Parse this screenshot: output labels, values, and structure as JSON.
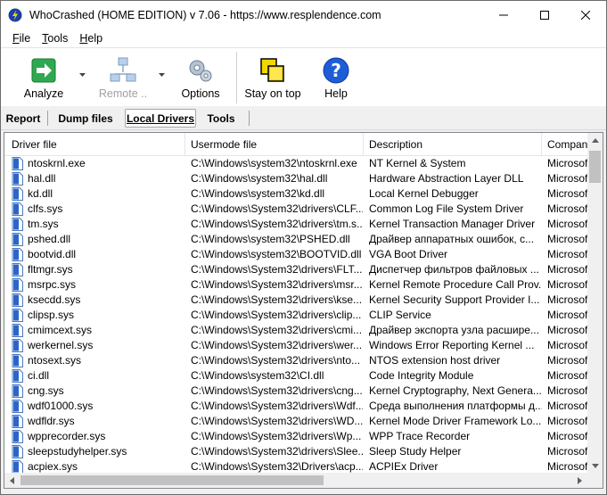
{
  "window": {
    "title": "WhoCrashed  (HOME EDITION)  v 7.06  -   https://www.resplendence.com",
    "controls": [
      "minimize",
      "maximize",
      "close"
    ]
  },
  "menu": [
    {
      "label": "File"
    },
    {
      "label": "Tools"
    },
    {
      "label": "Help"
    }
  ],
  "toolbar": {
    "analyze": "Analyze",
    "remote": "Remote ..",
    "options": "Options",
    "stay_on_top": "Stay on top",
    "help": "Help"
  },
  "tabs": [
    {
      "label": "Report",
      "active": false
    },
    {
      "label": "Dump files",
      "active": false
    },
    {
      "label": "Local Drivers",
      "active": true
    },
    {
      "label": "Tools",
      "active": false
    }
  ],
  "table": {
    "columns": [
      "Driver file",
      "Usermode file",
      "Description",
      "Company"
    ],
    "rows": [
      [
        "ntoskrnl.exe",
        "C:\\Windows\\system32\\ntoskrnl.exe",
        "NT Kernel & System",
        "Microsoft"
      ],
      [
        "hal.dll",
        "C:\\Windows\\system32\\hal.dll",
        "Hardware Abstraction Layer DLL",
        "Microsoft"
      ],
      [
        "kd.dll",
        "C:\\Windows\\system32\\kd.dll",
        "Local Kernel Debugger",
        "Microsoft"
      ],
      [
        "clfs.sys",
        "C:\\Windows\\System32\\drivers\\CLF...",
        "Common Log File System Driver",
        "Microsoft"
      ],
      [
        "tm.sys",
        "C:\\Windows\\System32\\drivers\\tm.s...",
        "Kernel Transaction Manager Driver",
        "Microsoft"
      ],
      [
        "pshed.dll",
        "C:\\Windows\\system32\\PSHED.dll",
        "Драйвер аппаратных ошибок, с...",
        "Microsoft"
      ],
      [
        "bootvid.dll",
        "C:\\Windows\\system32\\BOOTVID.dll",
        "VGA Boot Driver",
        "Microsoft"
      ],
      [
        "fltmgr.sys",
        "C:\\Windows\\System32\\drivers\\FLT...",
        "Диспетчер фильтров файловых ...",
        "Microsoft"
      ],
      [
        "msrpc.sys",
        "C:\\Windows\\System32\\drivers\\msr...",
        "Kernel Remote Procedure Call Prov...",
        "Microsoft"
      ],
      [
        "ksecdd.sys",
        "C:\\Windows\\System32\\drivers\\kse...",
        "Kernel Security Support Provider I...",
        "Microsoft"
      ],
      [
        "clipsp.sys",
        "C:\\Windows\\System32\\drivers\\clip...",
        "CLIP Service",
        "Microsoft"
      ],
      [
        "cmimcext.sys",
        "C:\\Windows\\System32\\drivers\\cmi...",
        "Драйвер экспорта узла расшире...",
        "Microsoft"
      ],
      [
        "werkernel.sys",
        "C:\\Windows\\System32\\drivers\\wer...",
        "Windows Error Reporting Kernel ...",
        "Microsoft"
      ],
      [
        "ntosext.sys",
        "C:\\Windows\\System32\\drivers\\nto...",
        "NTOS extension host driver",
        "Microsoft"
      ],
      [
        "ci.dll",
        "C:\\Windows\\system32\\CI.dll",
        "Code Integrity Module",
        "Microsoft"
      ],
      [
        "cng.sys",
        "C:\\Windows\\System32\\drivers\\cng...",
        "Kernel Cryptography, Next Genera...",
        "Microsoft"
      ],
      [
        "wdf01000.sys",
        "C:\\Windows\\System32\\drivers\\Wdf...",
        "Среда выполнения платформы д...",
        "Microsoft"
      ],
      [
        "wdfldr.sys",
        "C:\\Windows\\System32\\drivers\\WD...",
        "Kernel Mode Driver Framework Lo...",
        "Microsoft"
      ],
      [
        "wpprecorder.sys",
        "C:\\Windows\\System32\\drivers\\Wp...",
        "WPP Trace Recorder",
        "Microsoft"
      ],
      [
        "sleepstudyhelper.sys",
        "C:\\Windows\\System32\\drivers\\Slee...",
        "Sleep Study Helper",
        "Microsoft"
      ],
      [
        "acpiex.sys",
        "C:\\Windows\\System32\\Drivers\\acp...",
        "ACPIEx Driver",
        "Microsoft"
      ]
    ]
  },
  "colors": {
    "accent": "#1e5dd8",
    "title_bg": "#ffffff",
    "chrome_bg": "#f0f0f0",
    "disabled_text": "#a0a0a0"
  },
  "icons": {
    "app": "lightning-bolt-icon",
    "analyze": "green-arrow-icon",
    "remote": "network-computers-icon",
    "options": "gears-icon",
    "stay_on_top": "stacked-windows-icon",
    "help": "question-mark-icon",
    "driver_file": "document-icon"
  }
}
